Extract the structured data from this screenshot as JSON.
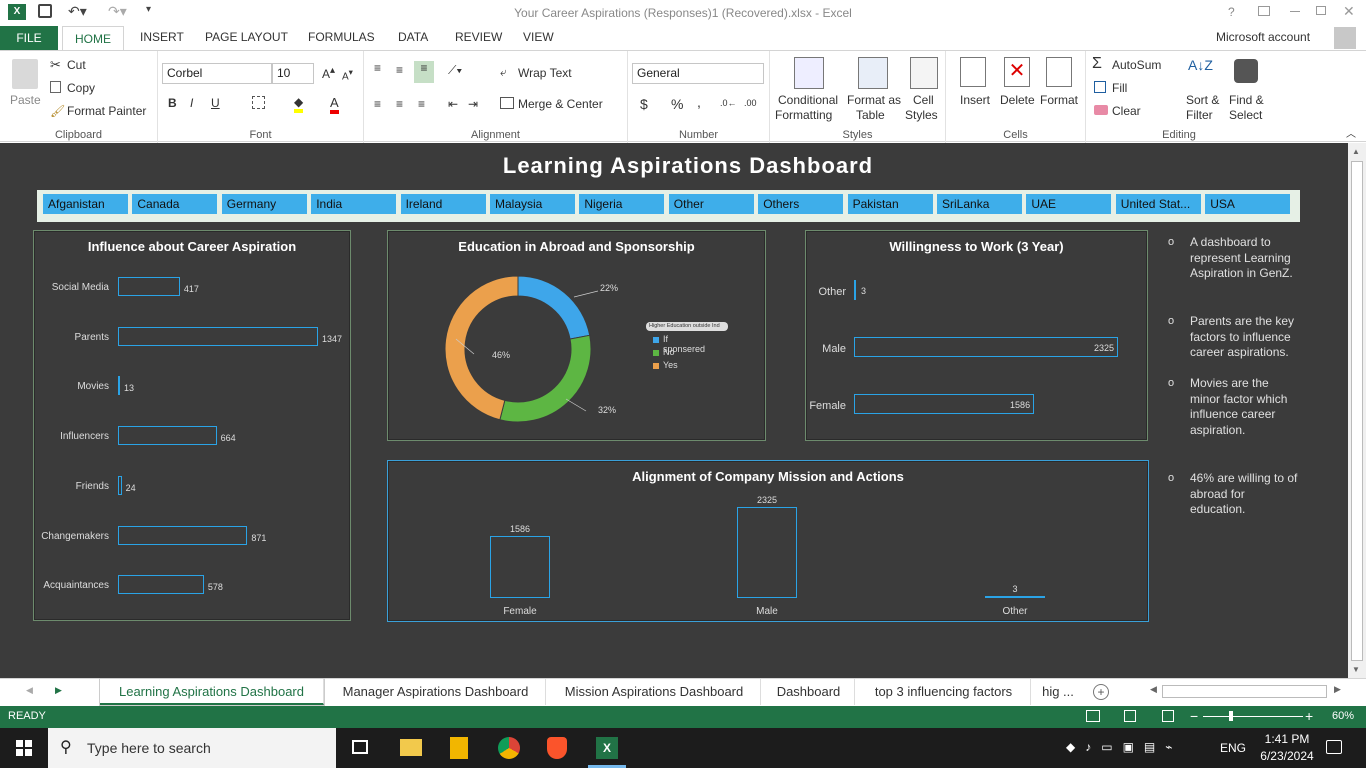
{
  "window": {
    "title": "Your Career Aspirations (Responses)1 (Recovered).xlsx - Excel"
  },
  "ribbon_tabs": {
    "file": "FILE",
    "home": "HOME",
    "insert": "INSERT",
    "page_layout": "PAGE LAYOUT",
    "formulas": "FORMULAS",
    "data": "DATA",
    "review": "REVIEW",
    "view": "VIEW",
    "account": "Microsoft account"
  },
  "clipboard": {
    "paste": "Paste",
    "cut": "Cut",
    "copy": "Copy",
    "format_painter": "Format Painter",
    "label": "Clipboard"
  },
  "font": {
    "name": "Corbel",
    "size": "10",
    "bold": "B",
    "italic": "I",
    "underline": "U",
    "label": "Font"
  },
  "alignment": {
    "wrap": "Wrap Text",
    "merge": "Merge & Center",
    "label": "Alignment"
  },
  "number": {
    "format": "General",
    "currency": "$",
    "percent": "%",
    "comma": ",",
    "label": "Number"
  },
  "styles": {
    "conditional": "Conditional",
    "conditional2": "Formatting",
    "format_as": "Format as",
    "format_as2": "Table",
    "cell": "Cell",
    "cell2": "Styles",
    "label": "Styles"
  },
  "cells": {
    "insert": "Insert",
    "delete": "Delete",
    "format": "Format",
    "label": "Cells"
  },
  "editing": {
    "autosum": "AutoSum",
    "fill": "Fill",
    "clear": "Clear",
    "sort": "Sort &",
    "sort2": "Filter",
    "find": "Find &",
    "find2": "Select",
    "label": "Editing"
  },
  "dashboard": {
    "title": "Learning Aspirations Dashboard"
  },
  "slicer": [
    "Afganistan",
    "Canada",
    "Germany",
    "India",
    "Ireland",
    "Malaysia",
    "Nigeria",
    "Other",
    "Others",
    "Pakistan",
    "SriLanka",
    "UAE",
    "United Stat...",
    "USA"
  ],
  "influence": {
    "title": "Influence about Career Aspiration",
    "labels": [
      "Social Media",
      "Parents",
      "Movies",
      "Influencers",
      "Friends",
      "Changemakers",
      "Acquaintances"
    ],
    "values": [
      "417",
      "1347",
      "13",
      "664",
      "24",
      "871",
      "578"
    ]
  },
  "education": {
    "title": "Education in Abroad and Sponsorship",
    "labels": [
      "22%",
      "32%",
      "46%"
    ],
    "filter": "Higher Education outside Ind",
    "legend": [
      "If sponsered",
      "No",
      "Yes"
    ]
  },
  "willingness": {
    "title": "Willingness to Work (3 Year)",
    "labels": [
      "Other",
      "Male",
      "Female"
    ],
    "values": [
      "3",
      "2325",
      "1586"
    ]
  },
  "alignment_chart": {
    "title": "Alignment of Company Mission and Actions",
    "labels": [
      "Female",
      "Male",
      "Other"
    ],
    "values": [
      "1586",
      "2325",
      "3"
    ]
  },
  "notes": [
    "A dashboard to represent Learning Aspiration in GenZ.",
    "Parents are the key factors to influence career aspirations.",
    "Movies are the minor factor which influence career aspiration.",
    "46% are willing to of abroad for education."
  ],
  "sheet_tabs": [
    "Learning Aspirations Dashboard",
    "Manager Aspirations Dashboard",
    "Mission Aspirations Dashboard",
    "Dashboard",
    "top 3 influencing factors",
    "hig ..."
  ],
  "status": {
    "ready": "READY",
    "zoom": "60%"
  },
  "taskbar": {
    "search": "Type here to search",
    "lang": "ENG",
    "time": "1:41 PM",
    "date": "6/23/2024"
  },
  "chart_data": [
    {
      "type": "bar",
      "title": "Influence about Career Aspiration",
      "categories": [
        "Social Media",
        "Parents",
        "Movies",
        "Influencers",
        "Friends",
        "Changemakers",
        "Acquaintances"
      ],
      "values": [
        417,
        1347,
        13,
        664,
        24,
        871,
        578
      ]
    },
    {
      "type": "pie",
      "title": "Education in Abroad and Sponsorship",
      "categories": [
        "If sponsered",
        "No",
        "Yes"
      ],
      "values": [
        22,
        32,
        46
      ]
    },
    {
      "type": "bar",
      "title": "Willingness to Work (3 Year)",
      "categories": [
        "Other",
        "Male",
        "Female"
      ],
      "values": [
        3,
        2325,
        1586
      ]
    },
    {
      "type": "bar",
      "title": "Alignment of Company Mission and Actions",
      "categories": [
        "Female",
        "Male",
        "Other"
      ],
      "values": [
        1586,
        2325,
        3
      ]
    }
  ]
}
